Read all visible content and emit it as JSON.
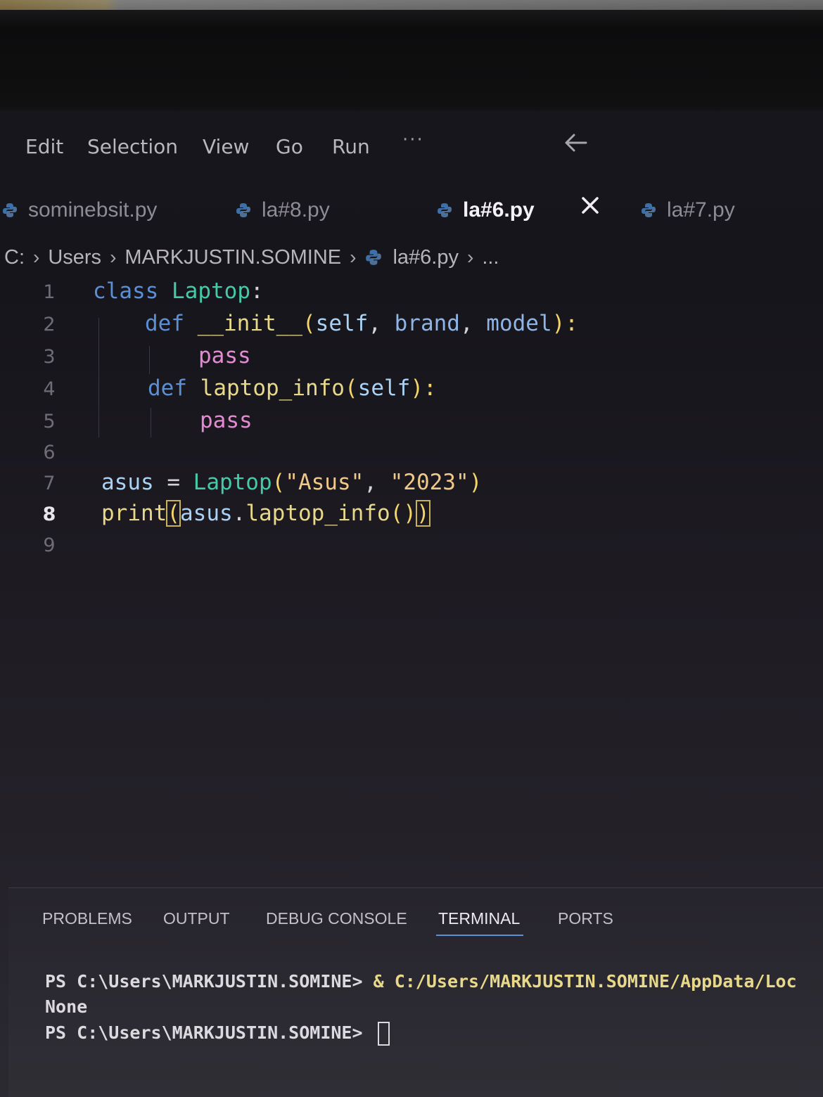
{
  "menu": {
    "items": [
      "Edit",
      "Selection",
      "View",
      "Go",
      "Run"
    ],
    "more": "···"
  },
  "icons": {
    "back": "arrow-left-icon",
    "close": "close-icon",
    "python": "python-icon"
  },
  "tabs": [
    {
      "label": "sominebsit.py",
      "active": false
    },
    {
      "label": "la#8.py",
      "active": false
    },
    {
      "label": "la#6.py",
      "active": true
    },
    {
      "label": "la#7.py",
      "active": false
    }
  ],
  "breadcrumb": {
    "drive": "C:",
    "folder1": "Users",
    "folder2": "MARKJUSTIN.SOMINE",
    "file": "la#6.py",
    "more": "..."
  },
  "editor": {
    "line_numbers": [
      "1",
      "2",
      "3",
      "4",
      "5",
      "6",
      "7",
      "8",
      "9"
    ],
    "current_line": 8,
    "code": {
      "l1_kw": "class",
      "l1_name": "Laptop",
      "l1_colon": ":",
      "l2_kw": "def",
      "l2_fn": "__init__",
      "l2_open": "(",
      "l2_p1": "self",
      "l2_sep1": ", ",
      "l2_p2": "brand",
      "l2_sep2": ", ",
      "l2_p3": "model",
      "l2_close": "):",
      "l3_pass": "pass",
      "l4_kw": "def",
      "l4_fn": "laptop_info",
      "l4_open": "(",
      "l4_p1": "self",
      "l4_close": "):",
      "l5_pass": "pass",
      "l7_var": "asus",
      "l7_eq": " = ",
      "l7_cls": "Laptop",
      "l7_open": "(",
      "l7_s1": "\"Asus\"",
      "l7_sep": ", ",
      "l7_s2": "\"2023\"",
      "l7_close": ")",
      "l8_fn": "print",
      "l8_open": "(",
      "l8_var": "asus",
      "l8_dot": ".",
      "l8_method": "laptop_info",
      "l8_call": "()",
      "l8_close": ")"
    }
  },
  "panel": {
    "tabs": [
      "PROBLEMS",
      "OUTPUT",
      "DEBUG CONSOLE",
      "TERMINAL",
      "PORTS"
    ],
    "active_tab": "TERMINAL",
    "terminal": {
      "line1_prompt": "PS C:\\Users\\MARKJUSTIN.SOMINE> ",
      "line1_cmd": "& C:/Users/MARKJUSTIN.SOMINE/AppData/Loc",
      "line2": "None",
      "line3_prompt": "PS C:\\Users\\MARKJUSTIN.SOMINE> "
    }
  },
  "colors": {
    "keyword": "#5b8fd6",
    "class_name": "#45c9a7",
    "function": "#e8d98a",
    "string": "#efc98a",
    "pass": "#e38bd2",
    "active_tab_underline": "#5b8fd6"
  }
}
